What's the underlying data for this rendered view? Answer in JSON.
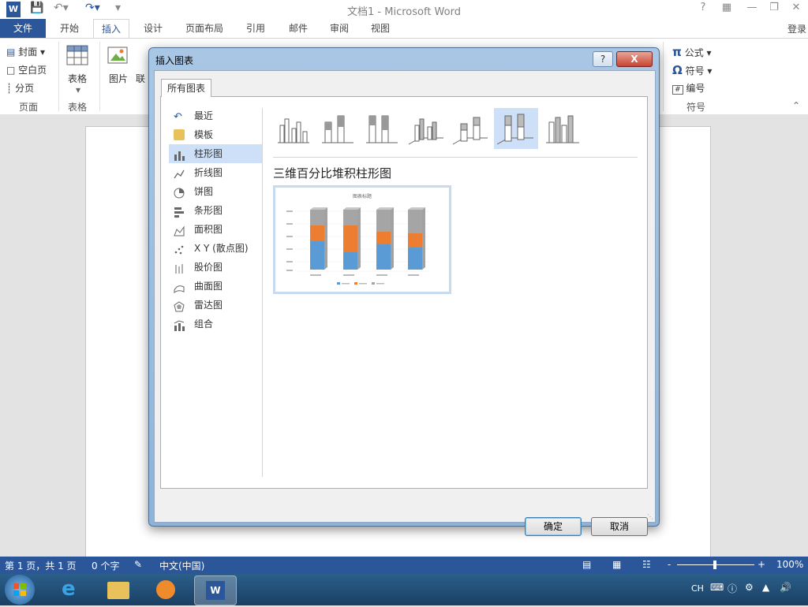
{
  "window": {
    "title": "文档1 - Microsoft Word",
    "help": "?",
    "login": "登录"
  },
  "tabs": [
    "文件",
    "开始",
    "插入",
    "设计",
    "页面布局",
    "引用",
    "邮件",
    "审阅",
    "视图"
  ],
  "ribbon": {
    "pages": {
      "cover": "封面",
      "blank": "空白页",
      "break": "分页",
      "label": "页面"
    },
    "tables": {
      "table": "表格",
      "label": "表格"
    },
    "illustrations": {
      "picture": "图片",
      "online": "联"
    },
    "symbols": {
      "equation": "公式",
      "symbol": "符号",
      "number": "编号",
      "label": "符号"
    }
  },
  "dialog": {
    "title": "插入图表",
    "help": "?",
    "close": "X",
    "tab": "所有图表",
    "categories": [
      "最近",
      "模板",
      "柱形图",
      "折线图",
      "饼图",
      "条形图",
      "面积图",
      "X Y (散点图)",
      "股价图",
      "曲面图",
      "雷达图",
      "组合"
    ],
    "selected_category": "柱形图",
    "chart_name": "三维百分比堆积柱形图",
    "preview_title": "图表标题",
    "ok": "确定",
    "cancel": "取消"
  },
  "status": {
    "page": "第 1 页，共 1 页",
    "words": "0 个字",
    "language": "中文(中国)",
    "zoom": "100%",
    "zoom_minus": "-",
    "zoom_plus": "+"
  },
  "taskbar": {
    "ime": "CH"
  },
  "colors": {
    "word_blue": "#2b579a",
    "series1": "#5b9bd5",
    "series2": "#ed7d31",
    "series3": "#a5a5a5",
    "selection": "#cde0f7"
  }
}
